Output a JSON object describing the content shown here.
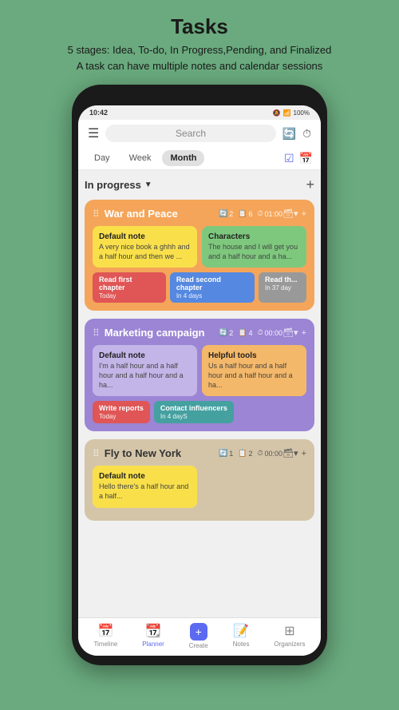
{
  "header": {
    "title": "Tasks",
    "subtitle_line1": "5 stages: Idea, To-do, In Progress,Pending, and Finalized",
    "subtitle_line2": "A task can have multiple notes and calendar sessions"
  },
  "status_bar": {
    "time": "10:42",
    "battery": "100%"
  },
  "app_bar": {
    "search_placeholder": "Search"
  },
  "view_tabs": {
    "day": "Day",
    "week": "Week",
    "month": "Month"
  },
  "section": {
    "label": "In progress",
    "add_label": "+"
  },
  "tasks": [
    {
      "id": "war-and-peace",
      "title": "War and Peace",
      "meta": [
        {
          "icon": "🔄",
          "value": "2"
        },
        {
          "icon": "📋",
          "value": "6"
        },
        {
          "icon": "⏱",
          "value": "01:00"
        }
      ],
      "color": "orange",
      "notes": [
        {
          "title": "Default note",
          "text": "A very nice book a ghhh and a half hour and then we ...",
          "color": "yellow"
        },
        {
          "title": "Characters",
          "text": "The house and I will get you and a half hour and a ha...",
          "color": "green"
        }
      ],
      "sessions": [
        {
          "label": "Read first chapter",
          "date": "Today",
          "color": "red"
        },
        {
          "label": "Read second chapter",
          "date": "In 4 days",
          "color": "blue"
        },
        {
          "label": "Read th...",
          "date": "In 37 day",
          "color": "gray"
        }
      ]
    },
    {
      "id": "marketing-campaign",
      "title": "Marketing campaign",
      "meta": [
        {
          "icon": "🔄",
          "value": "2"
        },
        {
          "icon": "📋",
          "value": "4"
        },
        {
          "icon": "⏱",
          "value": "00:00"
        }
      ],
      "color": "purple",
      "notes": [
        {
          "title": "Default note",
          "text": "I'm a half hour and a half hour and a half hour and a ha...",
          "color": "light-purple"
        },
        {
          "title": "Helpful tools",
          "text": "Us a half hour and a half hour and a half hour and a ha...",
          "color": "orange-light"
        }
      ],
      "sessions": [
        {
          "label": "Write reports",
          "date": "Today",
          "color": "red"
        },
        {
          "label": "Contact influencers",
          "date": "In 4 dayS",
          "color": "teal"
        }
      ]
    },
    {
      "id": "fly-to-new-york",
      "title": "Fly to New York",
      "meta": [
        {
          "icon": "🔄",
          "value": "1"
        },
        {
          "icon": "📋",
          "value": "2"
        },
        {
          "icon": "⏱",
          "value": "00:00"
        }
      ],
      "color": "beige",
      "notes": [
        {
          "title": "Default note",
          "text": "Hello there's a half hour and a half...",
          "color": "yellow"
        }
      ],
      "sessions": []
    }
  ],
  "bottom_nav": [
    {
      "id": "timeline",
      "label": "Timeline",
      "icon": "📅",
      "active": false
    },
    {
      "id": "planner",
      "label": "Planner",
      "icon": "📆",
      "active": true
    },
    {
      "id": "create",
      "label": "Create",
      "icon": "+",
      "active": false,
      "special": true
    },
    {
      "id": "notes",
      "label": "Notes",
      "icon": "📝",
      "active": false
    },
    {
      "id": "organizers",
      "label": "Organizers",
      "icon": "⊞",
      "active": false
    }
  ]
}
